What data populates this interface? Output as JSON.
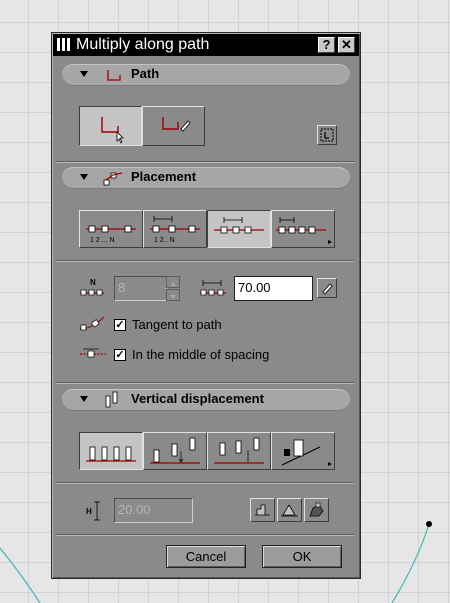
{
  "dialog": {
    "title": "Multiply along path",
    "help_label": "?",
    "close_label": "✕"
  },
  "sections": {
    "path": {
      "label": "Path"
    },
    "placement": {
      "label": "Placement"
    },
    "vertical": {
      "label": "Vertical displacement"
    }
  },
  "placement": {
    "count_value": "8",
    "distance_value": "70.00",
    "count_icon_label": "N",
    "button_labels": {
      "b1": "1  2 ... N",
      "b2": "1  2.. N"
    }
  },
  "options": {
    "tangent": {
      "label": "Tangent to path",
      "checked": "✓"
    },
    "middle": {
      "label": "In the middle of spacing",
      "checked": "✓"
    }
  },
  "vertical": {
    "height_value": "20.00",
    "height_icon_label": "H"
  },
  "footer": {
    "cancel_label": "Cancel",
    "ok_label": "OK"
  },
  "colors": {
    "accent_red": "#a00000",
    "dialog_bg": "#8a8a8a",
    "canvas_line": "#3fb8b0"
  }
}
